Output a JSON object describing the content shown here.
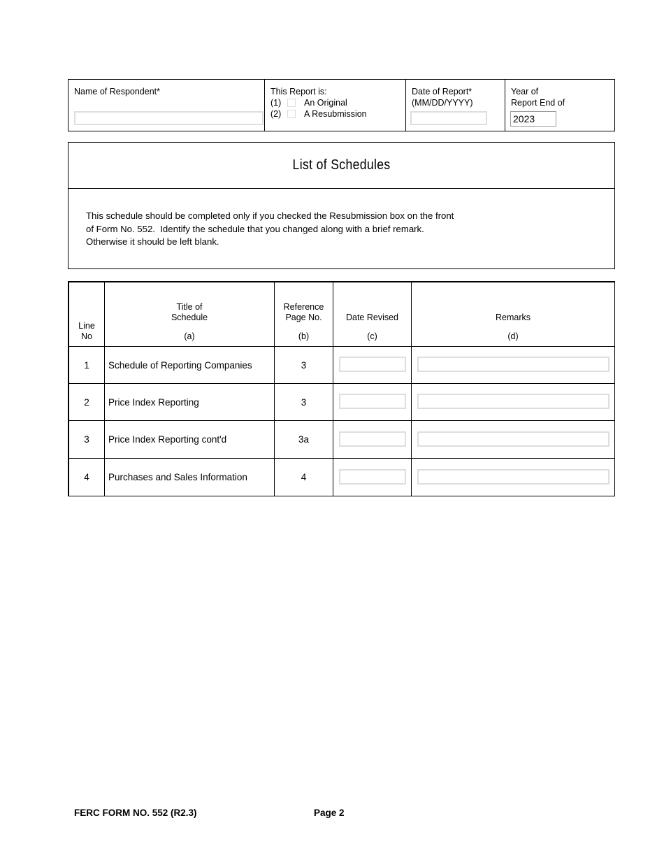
{
  "header": {
    "respondent": {
      "label": "Name of Respondent*",
      "value": "",
      "placeholder": ""
    },
    "report_is": {
      "label": "This Report is:",
      "options": [
        {
          "num": "(1)",
          "label": "An Original",
          "checked": false
        },
        {
          "num": "(2)",
          "label": "A Resubmission",
          "checked": false
        }
      ]
    },
    "date_of_report": {
      "label_line1": "Date of Report*",
      "label_line2": "(MM/DD/YYYY)",
      "value": "",
      "placeholder": ""
    },
    "year_end": {
      "label_line1": "Year of",
      "label_line2": "Report End of",
      "value": "2023",
      "placeholder": ""
    }
  },
  "title": "List of Schedules",
  "description": {
    "line1": "This schedule should be completed only if you checked the Resubmission box on the front",
    "line2": "of Form No. 552.  Identify the schedule that you changed along with a brief remark.",
    "line3": "Otherwise it should be left blank."
  },
  "table": {
    "headers": {
      "line_no_1": "Line",
      "line_no_2": "No",
      "title_1": "Title of",
      "title_2": "Schedule",
      "title_sub": "(a)",
      "ref_1": "Reference",
      "ref_2": "Page No.",
      "ref_sub": "(b)",
      "date_revised": "Date Revised",
      "date_sub": "(c)",
      "remarks": "Remarks",
      "remarks_sub": "(d)"
    },
    "rows": [
      {
        "line": "1",
        "title": "Schedule of Reporting Companies",
        "ref": "3",
        "date_revised": "",
        "remarks": ""
      },
      {
        "line": "2",
        "title": "Price Index Reporting",
        "ref": "3",
        "date_revised": "",
        "remarks": ""
      },
      {
        "line": "3",
        "title": "Price Index Reporting cont'd",
        "ref": "3a",
        "date_revised": "",
        "remarks": ""
      },
      {
        "line": "4",
        "title": "Purchases and Sales Information",
        "ref": "4",
        "date_revised": "",
        "remarks": ""
      }
    ]
  },
  "footer": {
    "form_no": "FERC FORM NO. 552 (R2.3)",
    "page": "Page 2"
  },
  "colors": {
    "border": "#000000",
    "input_border": "#dedede",
    "input_border_filled": "#9a9a9a",
    "text": "#000000"
  }
}
